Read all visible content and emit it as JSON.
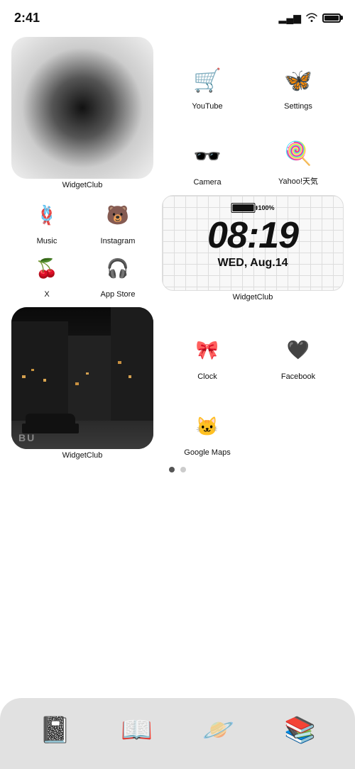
{
  "statusBar": {
    "time": "2:41",
    "batteryFull": true
  },
  "row1": {
    "widget": {
      "label": "WidgetClub"
    },
    "apps": [
      {
        "id": "youtube",
        "icon": "🛒",
        "label": "YouTube"
      },
      {
        "id": "settings",
        "icon": "🦋",
        "label": "Settings"
      },
      {
        "id": "camera",
        "icon": "🕶️",
        "label": "Camera"
      },
      {
        "id": "yahoo",
        "icon": "🍭",
        "label": "Yahoo!天気"
      }
    ]
  },
  "row2": {
    "apps": [
      {
        "id": "music",
        "icon": "🪢",
        "label": "Music"
      },
      {
        "id": "instagram",
        "icon": "🐻",
        "label": "Instagram"
      },
      {
        "id": "x",
        "icon": "🍒",
        "label": "X"
      },
      {
        "id": "appstore",
        "icon": "🎧",
        "label": "App Store"
      }
    ],
    "clockWidget": {
      "battery": "100%",
      "time": "08:19",
      "date": "WED, Aug.14",
      "label": "WidgetClub"
    }
  },
  "row3": {
    "photoWidget": {
      "label": "WidgetClub",
      "streetText": "BU"
    },
    "apps": [
      {
        "id": "clock",
        "icon": "🎀",
        "label": "Clock"
      },
      {
        "id": "facebook",
        "icon": "🖤",
        "label": "Facebook"
      },
      {
        "id": "googlemaps",
        "icon": "🐱",
        "label": "Google Maps"
      },
      {
        "id": "empty",
        "icon": "",
        "label": ""
      }
    ]
  },
  "dock": {
    "items": [
      {
        "id": "calendar",
        "icon": "📓"
      },
      {
        "id": "books",
        "icon": "📖"
      },
      {
        "id": "planet",
        "icon": "🪐"
      },
      {
        "id": "stack",
        "icon": "📚"
      }
    ]
  }
}
